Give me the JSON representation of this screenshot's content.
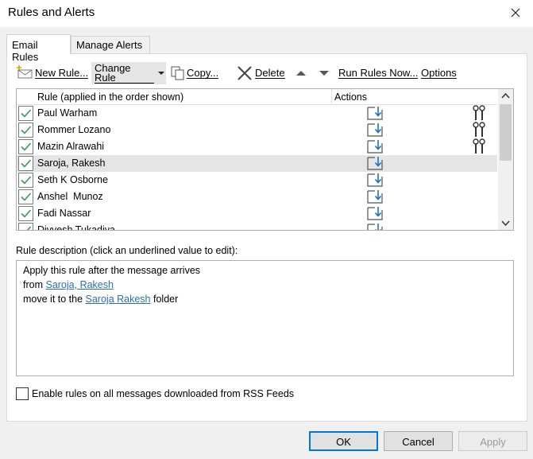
{
  "window": {
    "title": "Rules and Alerts"
  },
  "tabs": [
    {
      "label": "Email Rules",
      "active": true
    },
    {
      "label": "Manage Alerts",
      "active": false
    }
  ],
  "toolbar": {
    "new_rule": "New Rule...",
    "change_rule": "Change Rule",
    "copy": "Copy...",
    "delete": "Delete",
    "run_rules_now": "Run Rules Now...",
    "options": "Options"
  },
  "rules_list": {
    "columns": [
      "Rule (applied in the order shown)",
      "Actions"
    ],
    "rows": [
      {
        "name": "Paul Warham",
        "checked": true,
        "has_wrench": true,
        "selected": false
      },
      {
        "name": "Rommer Lozano",
        "checked": true,
        "has_wrench": true,
        "selected": false
      },
      {
        "name": "Mazin Alrawahi",
        "checked": true,
        "has_wrench": true,
        "selected": false
      },
      {
        "name": "Saroja, Rakesh",
        "checked": true,
        "has_wrench": false,
        "selected": true
      },
      {
        "name": "Seth K Osborne",
        "checked": true,
        "has_wrench": false,
        "selected": false
      },
      {
        "name": "Anshel  Munoz",
        "checked": true,
        "has_wrench": false,
        "selected": false
      },
      {
        "name": "Fadi Nassar",
        "checked": true,
        "has_wrench": false,
        "selected": false
      },
      {
        "name": "Divyesh Tukadiya",
        "checked": true,
        "has_wrench": false,
        "selected": false
      }
    ]
  },
  "description": {
    "label": "Rule description (click an underlined value to edit):",
    "line1": "Apply this rule after the message arrives",
    "line2_prefix": "from ",
    "line2_link": "Saroja, Rakesh",
    "line3_prefix": "move it to the ",
    "line3_link": "Saroja Rakesh",
    "line3_suffix": " folder"
  },
  "rss": {
    "label": "Enable rules on all messages downloaded from RSS Feeds",
    "checked": false
  },
  "buttons": {
    "ok": "OK",
    "cancel": "Cancel",
    "apply": "Apply"
  },
  "colors": {
    "accent": "#0078d7",
    "link": "#2a6ebb",
    "check": "#2e9e4f",
    "action_icon": "#1a73c8",
    "selection": "#e5e5e5"
  }
}
